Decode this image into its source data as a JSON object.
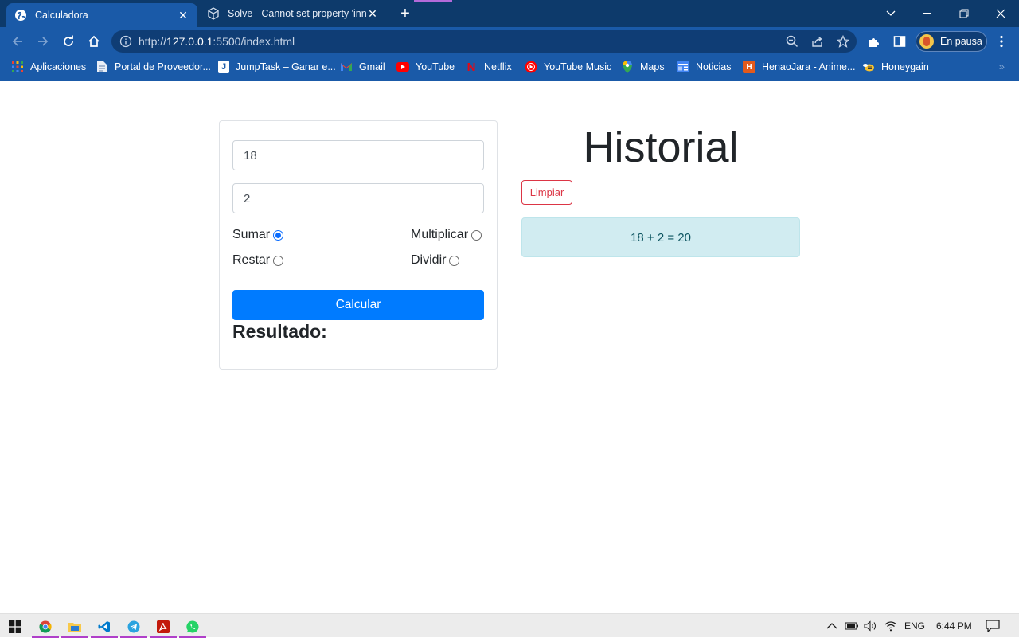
{
  "browser": {
    "tabs": [
      {
        "title": "Calculadora",
        "active": true
      },
      {
        "title": "Solve - Cannot set property 'inne",
        "active": false
      }
    ],
    "url_prefix": "http://",
    "url_host": "127.0.0.1",
    "url_rest": ":5500/index.html",
    "profile_label": "En pausa",
    "bookmarks": [
      {
        "label": "Aplicaciones",
        "icon": "apps-grid-icon"
      },
      {
        "label": "Portal de Proveedor...",
        "icon": "document-icon"
      },
      {
        "label": "JumpTask – Ganar e...",
        "icon": "jumptask-icon"
      },
      {
        "label": "Gmail",
        "icon": "gmail-icon"
      },
      {
        "label": "YouTube",
        "icon": "youtube-icon"
      },
      {
        "label": "Netflix",
        "icon": "netflix-icon"
      },
      {
        "label": "YouTube Music",
        "icon": "youtube-music-icon"
      },
      {
        "label": "Maps",
        "icon": "maps-icon"
      },
      {
        "label": "Noticias",
        "icon": "news-icon"
      },
      {
        "label": "HenaoJara - Anime...",
        "icon": "henaojara-icon"
      },
      {
        "label": "Honeygain",
        "icon": "honeygain-icon"
      }
    ],
    "more_bookmarks": "»"
  },
  "calculator": {
    "input1_value": "18",
    "input2_value": "2",
    "operations": {
      "sumar": "Sumar",
      "restar": "Restar",
      "multiplicar": "Multiplicar",
      "dividir": "Dividir",
      "selected": "sumar"
    },
    "calculate_label": "Calcular",
    "result_label": "Resultado:"
  },
  "history": {
    "title": "Historial",
    "clear_label": "Limpiar",
    "entries": [
      "18 + 2 = 20"
    ]
  },
  "taskbar": {
    "apps": [
      "start-icon",
      "chrome-icon",
      "file-explorer-icon",
      "vscode-icon",
      "telegram-icon",
      "acrobat-icon",
      "whatsapp-icon"
    ],
    "language": "ENG",
    "time": "6:44 PM"
  },
  "colors": {
    "chrome_dark": "#0d3a6b",
    "chrome_light": "#1a5aa8",
    "primary_button": "#007bff",
    "danger": "#dc3545",
    "info_bg": "#d1ecf1"
  }
}
